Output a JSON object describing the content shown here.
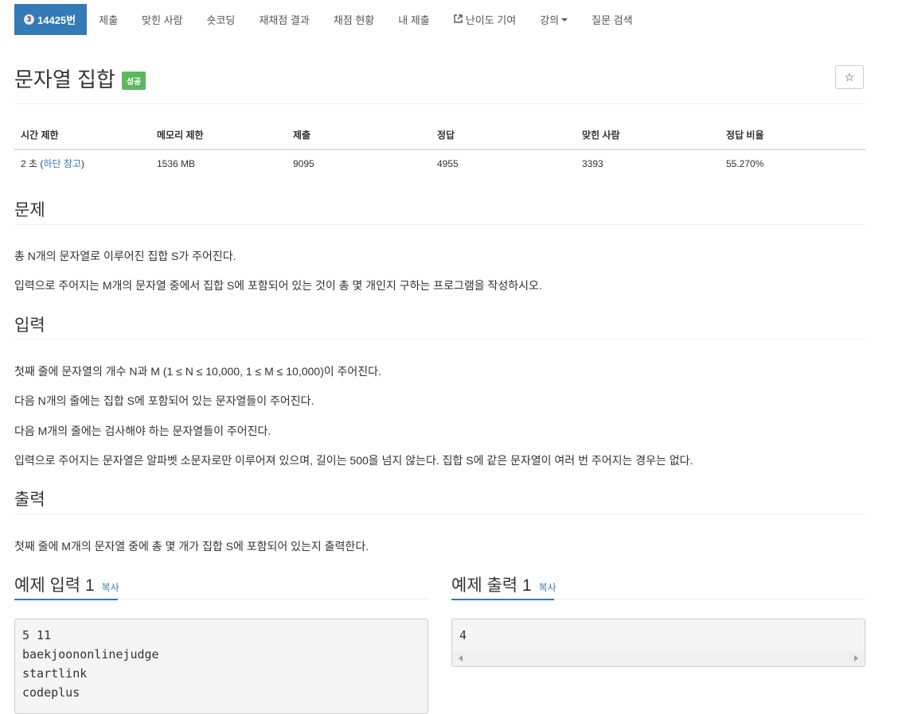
{
  "nav": {
    "problem_tier": "3",
    "problem_label": "14425번",
    "items": [
      "제출",
      "맞힌 사람",
      "숏코딩",
      "재채점 결과",
      "채점 현황",
      "내 제출"
    ],
    "difficulty": "난이도 기여",
    "lecture": "강의",
    "search": "질문 검색"
  },
  "title": "문자열 집합",
  "status_badge": "성공",
  "star_icon": "☆",
  "info": {
    "headers": [
      "시간 제한",
      "메모리 제한",
      "제출",
      "정답",
      "맞힌 사람",
      "정답 비율"
    ],
    "time_limit": "2 초",
    "time_note_open": " (",
    "time_note_link": "하단 참고",
    "time_note_close": ")",
    "memory": "1536 MB",
    "submissions": "9095",
    "accepted": "4955",
    "solvers": "3393",
    "ratio": "55.270%"
  },
  "problem": {
    "heading": "문제",
    "paragraphs": [
      "총 N개의 문자열로 이루어진 집합 S가 주어진다.",
      "입력으로 주어지는 M개의 문자열 중에서 집합 S에 포함되어 있는 것이 총 몇 개인지 구하는 프로그램을 작성하시오."
    ]
  },
  "input": {
    "heading": "입력",
    "paragraphs": [
      "첫째 줄에 문자열의 개수 N과 M (1 ≤ N ≤ 10,000, 1 ≤ M ≤ 10,000)이 주어진다.",
      "다음 N개의 줄에는 집합 S에 포함되어 있는 문자열들이 주어진다.",
      "다음 M개의 줄에는 검사해야 하는 문자열들이 주어진다.",
      "입력으로 주어지는 문자열은 알파벳 소문자로만 이루어져 있으며, 길이는 500을 넘지 않는다. 집합 S에 같은 문자열이 여러 번 주어지는 경우는 없다."
    ]
  },
  "output": {
    "heading": "출력",
    "paragraphs": [
      "첫째 줄에 M개의 문자열 중에 총 몇 개가 집합 S에 포함되어 있는지 출력한다."
    ]
  },
  "sample_input": {
    "heading": "예제 입력 1",
    "copy": "복사",
    "lines": [
      "5 11",
      "baekjoononlinejudge",
      "startlink",
      "codeplus"
    ]
  },
  "sample_output": {
    "heading": "예제 출력 1",
    "copy": "복사",
    "lines": [
      "4"
    ]
  }
}
